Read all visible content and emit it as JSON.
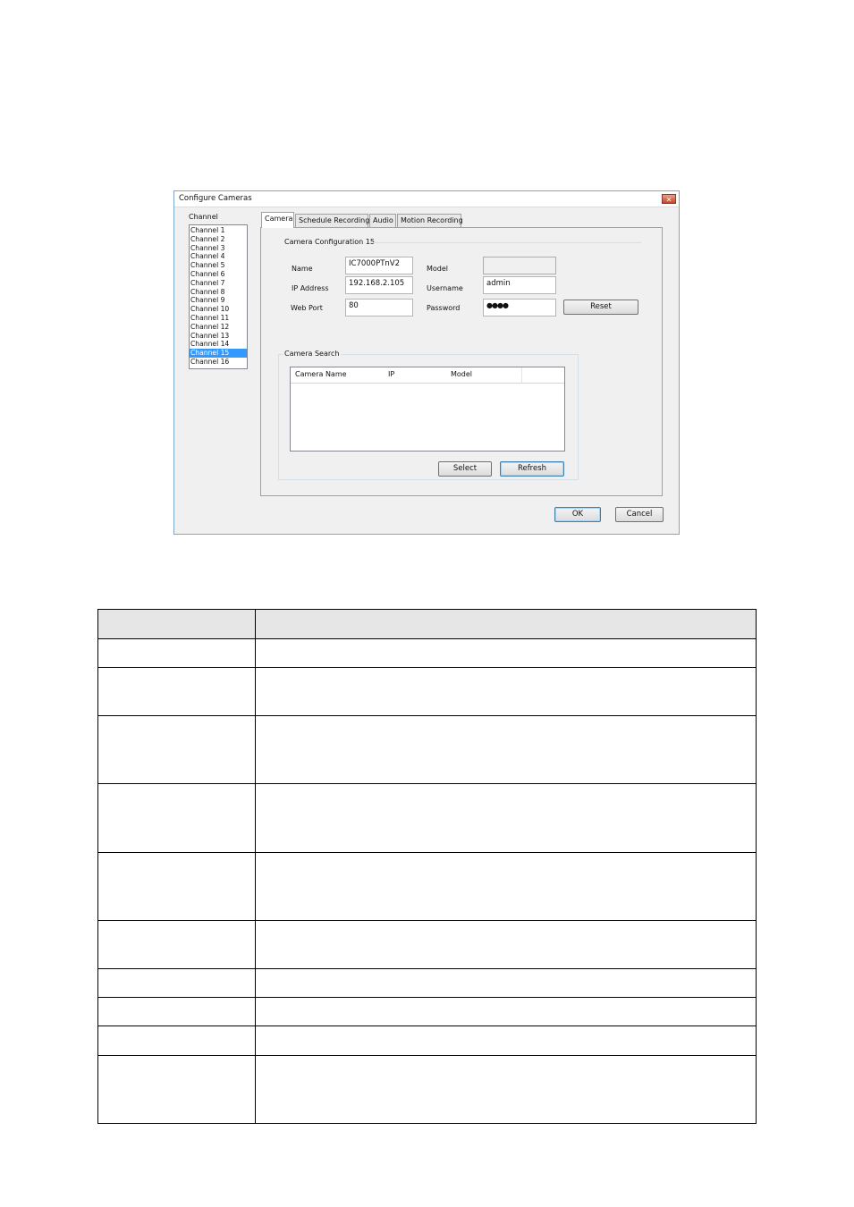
{
  "dialog": {
    "title": "Configure Cameras",
    "close_glyph": "✕",
    "channel_label": "Channel",
    "channels": [
      "Channel 1",
      "Channel 2",
      "Channel 3",
      "Channel 4",
      "Channel 5",
      "Channel 6",
      "Channel 7",
      "Channel 8",
      "Channel 9",
      "Channel 10",
      "Channel 11",
      "Channel 12",
      "Channel 13",
      "Channel 14",
      "Channel 15",
      "Channel 16"
    ],
    "selected_channel": "Channel 15",
    "tabs": [
      "Camera",
      "Schedule Recording",
      "Audio",
      "Motion Recording"
    ],
    "active_tab": "Camera",
    "config": {
      "group_title": "Camera Configuration 15",
      "name_label": "Name",
      "name_value": "IC7000PTnV2",
      "ip_label": "IP Address",
      "ip_value": "192.168.2.105",
      "port_label": "Web Port",
      "port_value": "80",
      "model_label": "Model",
      "model_value": "",
      "username_label": "Username",
      "username_value": "admin",
      "password_label": "Password",
      "password_value": "●●●●",
      "reset_label": "Reset"
    },
    "search": {
      "group_title": "Camera Search",
      "columns": [
        "Camera Name",
        "IP",
        "Model"
      ],
      "select_label": "Select",
      "refresh_label": "Refresh"
    },
    "ok_label": "OK",
    "cancel_label": "Cancel"
  },
  "colors": {
    "selection": "#3399ff",
    "dialog_border": "#7aa7cf",
    "table_header": "#e6e6e6"
  }
}
